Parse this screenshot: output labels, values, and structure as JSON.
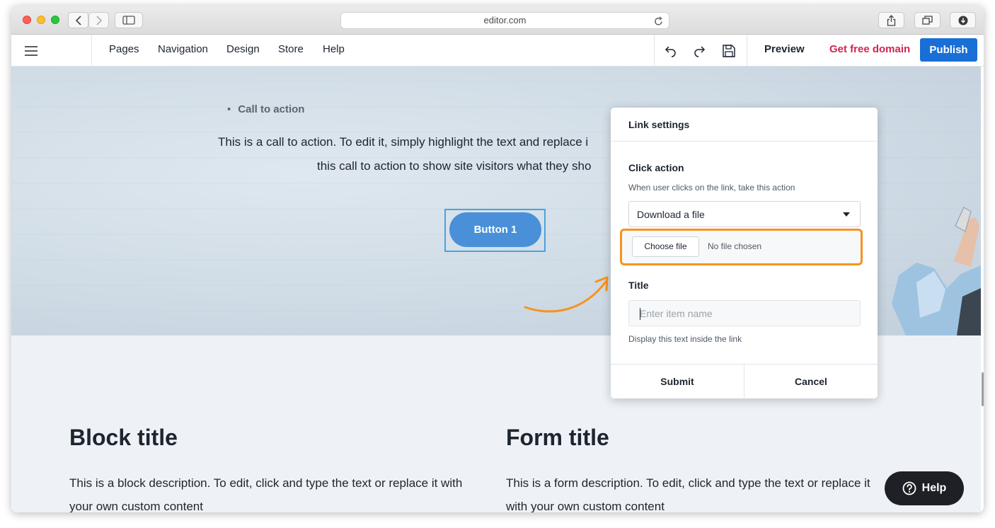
{
  "browser": {
    "url": "editor.com",
    "colors": {
      "close": "#ff5f57",
      "minimize": "#febc2e",
      "zoom": "#28c840"
    }
  },
  "toolbar": {
    "nav": [
      "Pages",
      "Navigation",
      "Design",
      "Store",
      "Help"
    ],
    "preview_label": "Preview",
    "free_domain_label": "Get free domain",
    "publish_label": "Publish",
    "icons": [
      "menu-icon",
      "undo-icon",
      "redo-icon",
      "save-icon"
    ]
  },
  "hero": {
    "bullet": "Call to action",
    "cta_line1": "This is a call to action. To edit it, simply highlight the text and replace i",
    "cta_line2": "this call to action to show site visitors what they sho",
    "button_label": "Button 1"
  },
  "sections": {
    "block_title": "Block title",
    "block_desc": "This is a block description. To edit, click and type the text or replace it with your own custom content",
    "form_title": "Form title",
    "form_desc": "This is a form description. To edit, click and type the text or replace it with your own custom content"
  },
  "modal": {
    "title": "Link settings",
    "click_action_label": "Click action",
    "click_action_help": "When user clicks on the link, take this action",
    "select_value": "Download a file",
    "choose_file_label": "Choose file",
    "file_status": "No file chosen",
    "title_label": "Title",
    "title_placeholder": "Enter item name",
    "title_help": "Display this text inside the link",
    "submit_label": "Submit",
    "cancel_label": "Cancel"
  },
  "help_button": {
    "label": "Help"
  },
  "colors": {
    "accent": "#1a6fd6",
    "domain_link": "#d3254f",
    "highlight": "#f7931e",
    "button": "#4a90d9"
  }
}
